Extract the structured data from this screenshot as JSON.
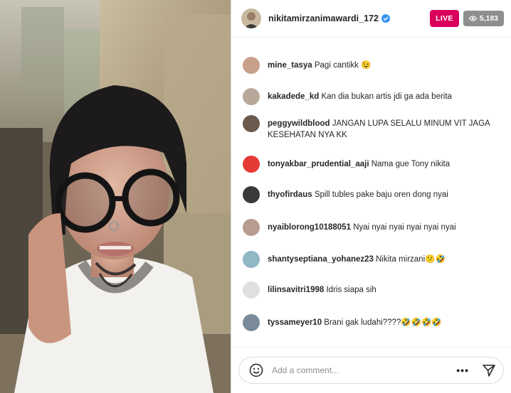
{
  "stream": {
    "username": "nikitamirzanimawardi_172",
    "live_label": "LIVE",
    "viewer_count": "5,183"
  },
  "comments": [
    {
      "user": "mine_tasya",
      "text": "Pagi cantikk 😉"
    },
    {
      "user": "kakadede_kd",
      "text": "Kan dia bukan artis jdi ga ada berita"
    },
    {
      "user": "peggywildblood",
      "text": "JANGAN LUPA SELALU MINUM VIT JAGA KESEHATAN NYA KK"
    },
    {
      "user": "tonyakbar_prudential_aaji",
      "text": "Nama gue Tony nikita"
    },
    {
      "user": "thyofirdaus",
      "text": "Spill tubles pake baju oren dong nyai"
    },
    {
      "user": "nyaiblorong10188051",
      "text": "Nyai nyai nyai nyai nyai nyai"
    },
    {
      "user": "shantyseptiana_yohanez23",
      "text": "Nikita mirzani😕🤣"
    },
    {
      "user": "lilinsavitri1998",
      "text": "Idris siapa sih"
    },
    {
      "user": "tyssameyer10",
      "text": "Brani gak ludahi????🤣🤣🤣🤣"
    }
  ],
  "comment_avatar_colors": [
    "#c9a08a",
    "#b8a89a",
    "#6b5a4e",
    "#e53935",
    "#3a3a3a",
    "#b79c8f",
    "#8fb7c4",
    "#e0e0e0",
    "#7a8a99"
  ],
  "composer": {
    "placeholder": "Add a comment...",
    "emoji_icon": "smiley-icon",
    "more_icon": "more-horizontal-icon",
    "send_icon": "paper-plane-icon"
  },
  "colors": {
    "live": "#d8005b",
    "verified": "#3897f0",
    "viewers_bg": "#8e8e8e"
  }
}
